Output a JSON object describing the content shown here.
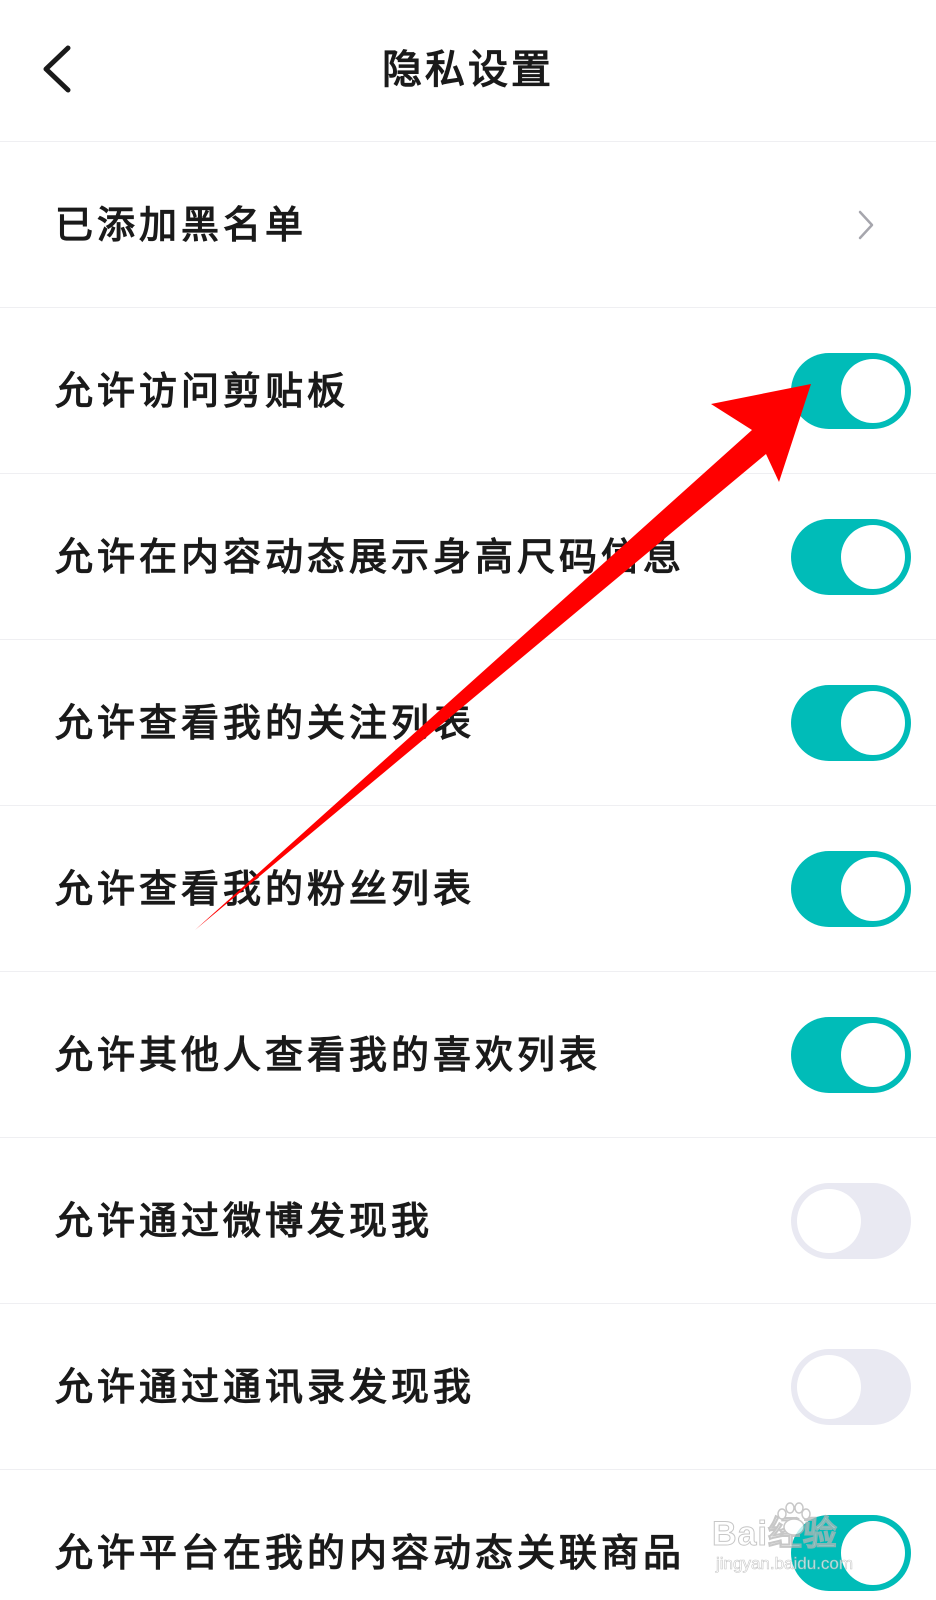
{
  "header": {
    "title": "隐私设置",
    "back_icon": "chevron-left-icon"
  },
  "settings": [
    {
      "key": "blacklist",
      "label": "已添加黑名单",
      "type": "link",
      "icon": "chevron-right-icon"
    },
    {
      "key": "clipboard",
      "label": "允许访问剪贴板",
      "type": "toggle",
      "on": true
    },
    {
      "key": "height_size",
      "label": "允许在内容动态展示身高尺码信息",
      "type": "toggle",
      "on": true
    },
    {
      "key": "following_list",
      "label": "允许查看我的关注列表",
      "type": "toggle",
      "on": true
    },
    {
      "key": "fans_list",
      "label": "允许查看我的粉丝列表",
      "type": "toggle",
      "on": true
    },
    {
      "key": "likes_list",
      "label": "允许其他人查看我的喜欢列表",
      "type": "toggle",
      "on": true
    },
    {
      "key": "weibo_discover",
      "label": "允许通过微博发现我",
      "type": "toggle",
      "on": false
    },
    {
      "key": "contacts_discover",
      "label": "允许通过通讯录发现我",
      "type": "toggle",
      "on": false
    },
    {
      "key": "link_products",
      "label": "允许平台在我的内容动态关联商品",
      "type": "toggle",
      "on": true
    }
  ],
  "colors": {
    "toggle_on": "#00bcb8",
    "toggle_off": "#e9e9f2",
    "annotation_arrow": "#ff0000"
  },
  "watermark": {
    "main": "Bai经验",
    "sub": "jingyan.baidu.com"
  }
}
